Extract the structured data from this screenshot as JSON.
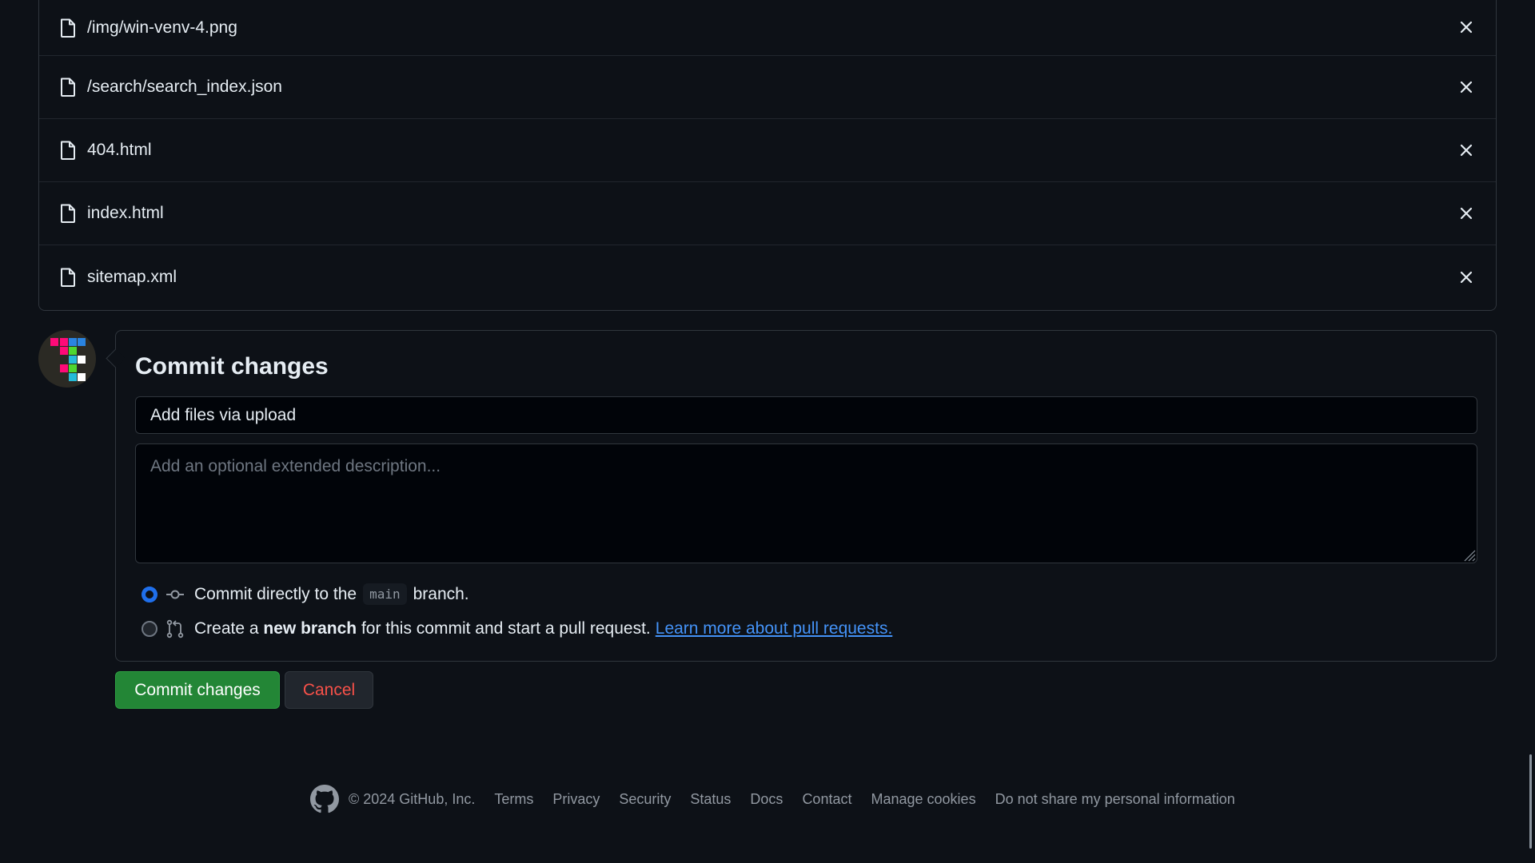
{
  "files": [
    {
      "name": "/img/win-venv-4.png",
      "icon": "file-icon",
      "remove_icon": "x-icon"
    },
    {
      "name": "/search/search_index.json",
      "icon": "file-icon",
      "remove_icon": "x-icon"
    },
    {
      "name": "404.html",
      "icon": "file-icon",
      "remove_icon": "x-icon"
    },
    {
      "name": "index.html",
      "icon": "file-icon",
      "remove_icon": "x-icon"
    },
    {
      "name": "sitemap.xml",
      "icon": "file-icon",
      "remove_icon": "x-icon"
    }
  ],
  "commit": {
    "title": "Commit changes",
    "summary_value": "Add files via upload",
    "description_placeholder": "Add an optional extended description...",
    "options": [
      {
        "checked": true,
        "icon": "git-commit-icon",
        "text_before": "Commit directly to the",
        "branch": "main",
        "text_after": "branch."
      },
      {
        "checked": false,
        "icon": "git-pull-request-icon",
        "text_before": "Create a",
        "bold": "new branch",
        "text_after": "for this commit and start a pull request.",
        "link": "Learn more about pull requests."
      }
    ],
    "submit_label": "Commit changes",
    "cancel_label": "Cancel"
  },
  "colors": {
    "accent_blue": "#1f6feb",
    "link_blue": "#4493f8",
    "primary_green": "#238636",
    "danger_red": "#f85149",
    "background": "#0d1117"
  },
  "footer": {
    "logo_icon": "github-logo-icon",
    "copyright": "© 2024 GitHub, Inc.",
    "links": [
      "Terms",
      "Privacy",
      "Security",
      "Status",
      "Docs",
      "Contact",
      "Manage cookies",
      "Do not share my personal information"
    ]
  }
}
